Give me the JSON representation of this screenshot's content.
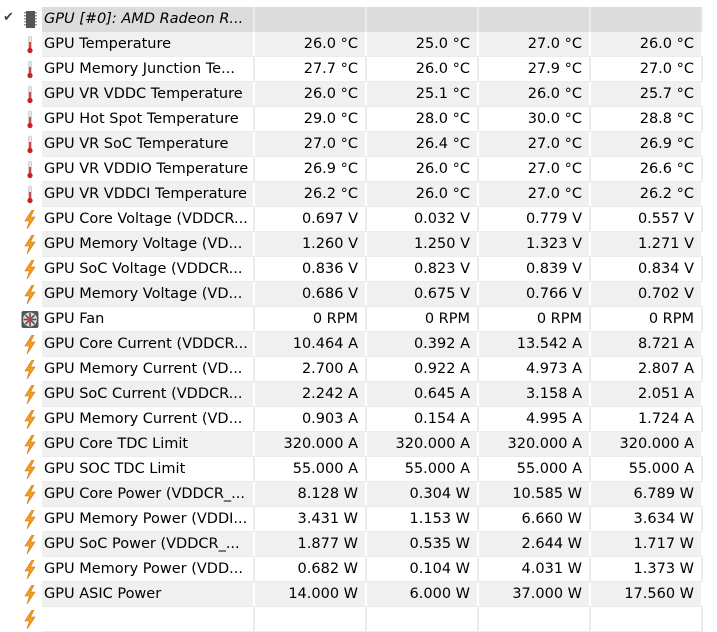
{
  "device": {
    "title": "GPU [#0]: AMD Radeon R...",
    "expanded_icon": "checkmark-icon",
    "icon": "chip-icon"
  },
  "colors": {
    "row_alt": "#f0f0f0",
    "header": "#dcdcdc",
    "thermometer": "#cc1f1f",
    "bolt": "#f0a020"
  },
  "rows": [
    {
      "name": "GPU Temperature",
      "icon": "thermometer",
      "current": "26.0 °C",
      "min": "25.0 °C",
      "max": "27.0 °C",
      "avg": "26.0 °C"
    },
    {
      "name": "GPU Memory Junction Te...",
      "icon": "thermometer",
      "current": "27.7 °C",
      "min": "26.0 °C",
      "max": "27.9 °C",
      "avg": "27.0 °C"
    },
    {
      "name": "GPU VR VDDC Temperature",
      "icon": "thermometer",
      "current": "26.0 °C",
      "min": "25.1 °C",
      "max": "26.0 °C",
      "avg": "25.7 °C"
    },
    {
      "name": "GPU Hot Spot Temperature",
      "icon": "thermometer",
      "current": "29.0 °C",
      "min": "28.0 °C",
      "max": "30.0 °C",
      "avg": "28.8 °C"
    },
    {
      "name": "GPU VR SoC Temperature",
      "icon": "thermometer",
      "current": "27.0 °C",
      "min": "26.4 °C",
      "max": "27.0 °C",
      "avg": "26.9 °C"
    },
    {
      "name": "GPU VR VDDIO Temperature",
      "icon": "thermometer",
      "current": "26.9 °C",
      "min": "26.0 °C",
      "max": "27.0 °C",
      "avg": "26.6 °C"
    },
    {
      "name": "GPU VR VDDCI Temperature",
      "icon": "thermometer",
      "current": "26.2 °C",
      "min": "26.0 °C",
      "max": "27.0 °C",
      "avg": "26.2 °C"
    },
    {
      "name": "GPU Core Voltage (VDDCR...",
      "icon": "bolt",
      "current": "0.697 V",
      "min": "0.032 V",
      "max": "0.779 V",
      "avg": "0.557 V"
    },
    {
      "name": "GPU Memory Voltage (VD...",
      "icon": "bolt",
      "current": "1.260 V",
      "min": "1.250 V",
      "max": "1.323 V",
      "avg": "1.271 V"
    },
    {
      "name": "GPU SoC Voltage (VDDCR...",
      "icon": "bolt",
      "current": "0.836 V",
      "min": "0.823 V",
      "max": "0.839 V",
      "avg": "0.834 V"
    },
    {
      "name": "GPU Memory Voltage (VD...",
      "icon": "bolt",
      "current": "0.686 V",
      "min": "0.675 V",
      "max": "0.766 V",
      "avg": "0.702 V"
    },
    {
      "name": "GPU Fan",
      "icon": "fan",
      "current": "0 RPM",
      "min": "0 RPM",
      "max": "0 RPM",
      "avg": "0 RPM"
    },
    {
      "name": "GPU Core Current (VDDCR...",
      "icon": "bolt",
      "current": "10.464 A",
      "min": "0.392 A",
      "max": "13.542 A",
      "avg": "8.721 A"
    },
    {
      "name": "GPU Memory Current (VD...",
      "icon": "bolt",
      "current": "2.700 A",
      "min": "0.922 A",
      "max": "4.973 A",
      "avg": "2.807 A"
    },
    {
      "name": "GPU SoC Current (VDDCR...",
      "icon": "bolt",
      "current": "2.242 A",
      "min": "0.645 A",
      "max": "3.158 A",
      "avg": "2.051 A"
    },
    {
      "name": "GPU Memory Current (VD...",
      "icon": "bolt",
      "current": "0.903 A",
      "min": "0.154 A",
      "max": "4.995 A",
      "avg": "1.724 A"
    },
    {
      "name": "GPU Core TDC Limit",
      "icon": "bolt",
      "current": "320.000 A",
      "min": "320.000 A",
      "max": "320.000 A",
      "avg": "320.000 A"
    },
    {
      "name": "GPU SOC TDC Limit",
      "icon": "bolt",
      "current": "55.000 A",
      "min": "55.000 A",
      "max": "55.000 A",
      "avg": "55.000 A"
    },
    {
      "name": "GPU Core Power (VDDCR_...",
      "icon": "bolt",
      "current": "8.128 W",
      "min": "0.304 W",
      "max": "10.585 W",
      "avg": "6.789 W"
    },
    {
      "name": "GPU Memory Power (VDDI...",
      "icon": "bolt",
      "current": "3.431 W",
      "min": "1.153 W",
      "max": "6.660 W",
      "avg": "3.634 W"
    },
    {
      "name": "GPU SoC Power (VDDCR_...",
      "icon": "bolt",
      "current": "1.877 W",
      "min": "0.535 W",
      "max": "2.644 W",
      "avg": "1.717 W"
    },
    {
      "name": "GPU Memory Power (VDD...",
      "icon": "bolt",
      "current": "0.682 W",
      "min": "0.104 W",
      "max": "4.031 W",
      "avg": "1.373 W"
    },
    {
      "name": "GPU ASIC Power",
      "icon": "bolt",
      "current": "14.000 W",
      "min": "6.000 W",
      "max": "37.000 W",
      "avg": "17.560 W"
    }
  ]
}
